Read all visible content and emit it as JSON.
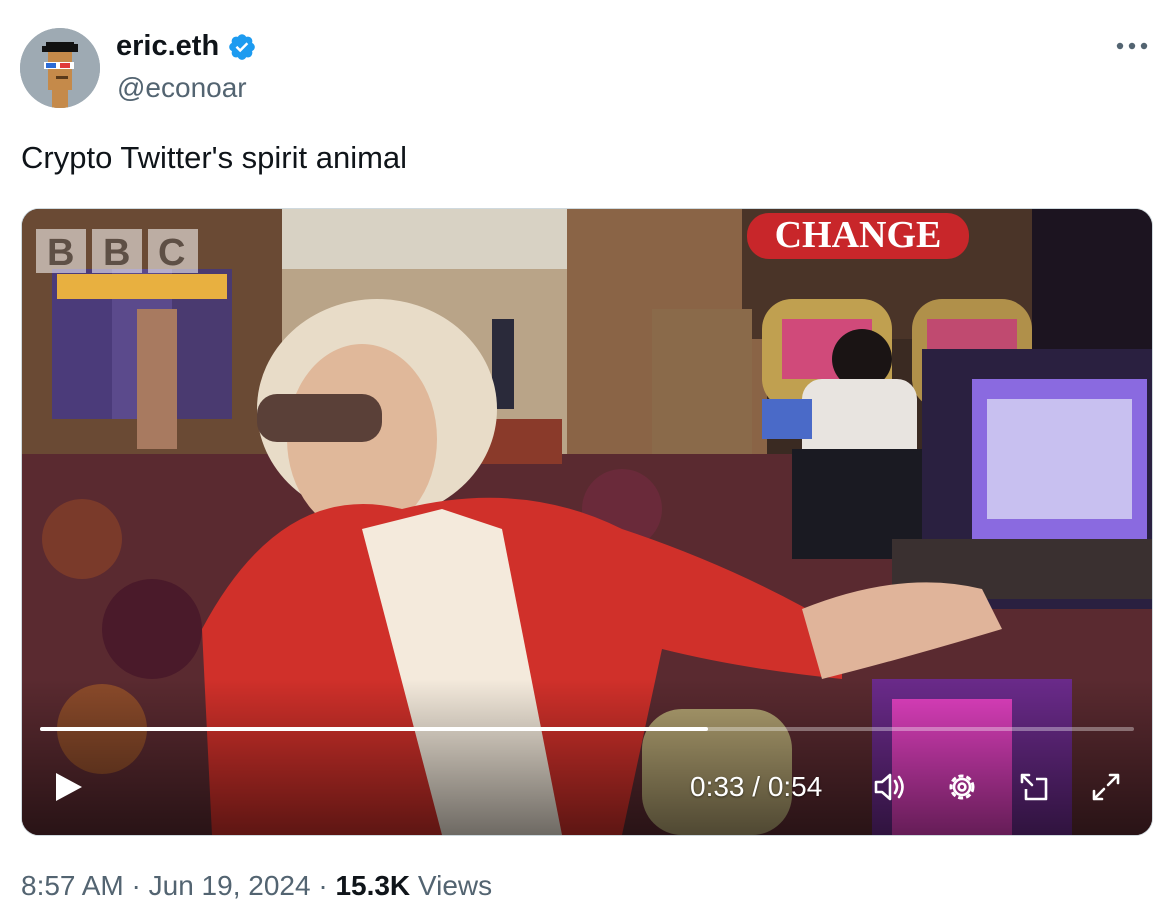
{
  "author": {
    "display_name": "eric.eth",
    "handle": "@econoar",
    "verified": true,
    "verified_color": "#1d9bf0"
  },
  "tweet": {
    "text": "Crypto Twitter's spirit animal"
  },
  "video": {
    "watermark": "BBC",
    "sign_text": "CHANGE",
    "time_display": "0:33 / 0:54",
    "progress_fraction": 0.611,
    "controls": [
      "play-icon",
      "volume-icon",
      "settings-icon",
      "pip-icon",
      "fullscreen-icon"
    ]
  },
  "meta": {
    "time": "8:57 AM",
    "sep1": " · ",
    "date": "Jun 19, 2024",
    "sep2": " · ",
    "views_count": "15.3K",
    "views_label": " Views"
  },
  "colors": {
    "text_primary": "#0f1419",
    "text_secondary": "#536471",
    "accent": "#1d9bf0"
  }
}
